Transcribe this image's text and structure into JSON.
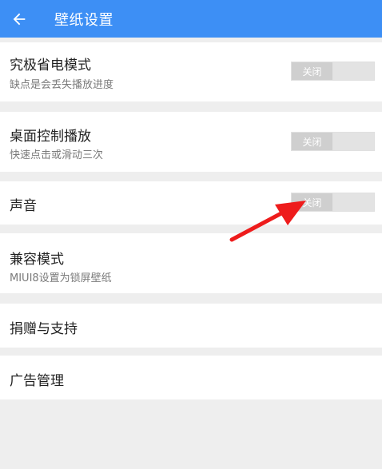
{
  "header": {
    "title": "壁纸设置",
    "back_icon": "arrow-left-icon"
  },
  "settings": [
    {
      "label": "究极省电模式",
      "sub": "缺点是会丢失播放进度",
      "toggle": "关闭"
    },
    {
      "label": "桌面控制播放",
      "sub": "快速点击或滑动三次",
      "toggle": "关闭"
    },
    {
      "label": "声音",
      "toggle": "关闭"
    },
    {
      "label": "兼容模式",
      "sub": "MIUI8设置为锁屏壁纸"
    },
    {
      "label": "捐赠与支持"
    },
    {
      "label": "广告管理"
    }
  ],
  "colors": {
    "appbar": "#3d8ff5",
    "background": "#eeeeee",
    "annotation_arrow": "#ee1c1c"
  }
}
